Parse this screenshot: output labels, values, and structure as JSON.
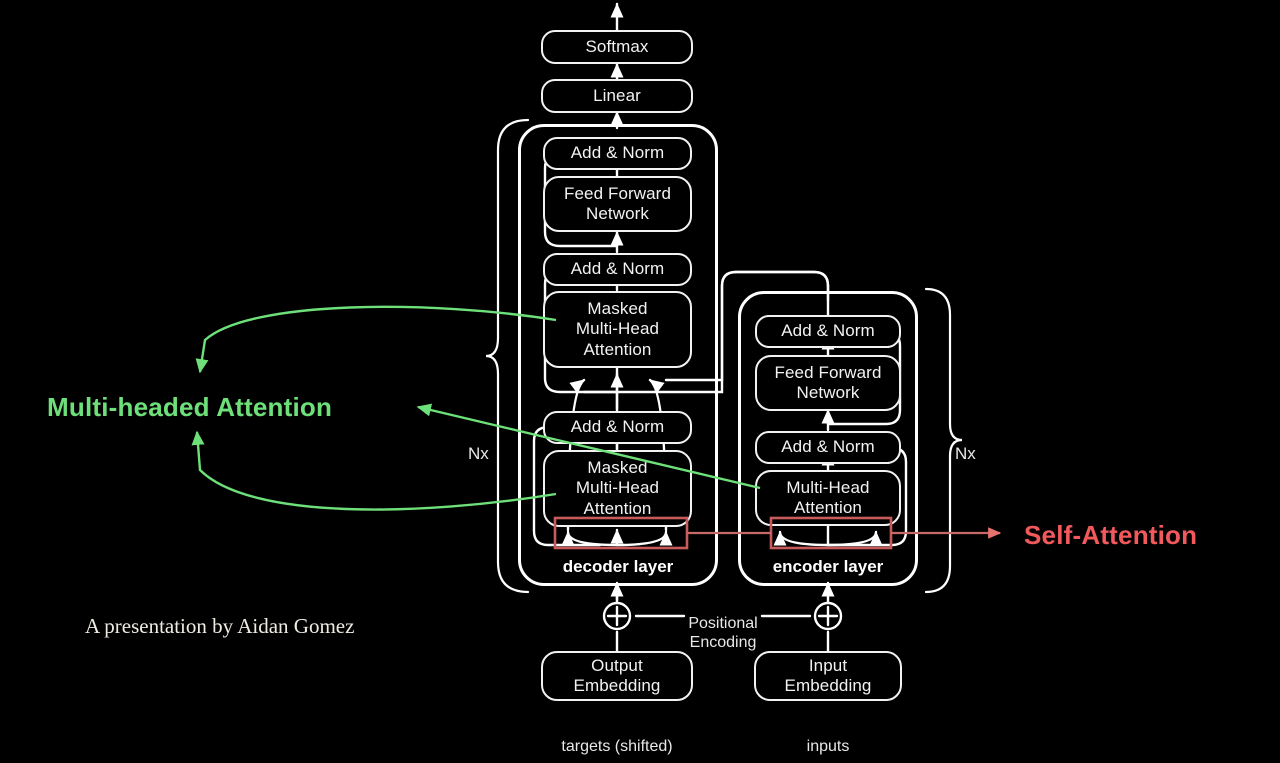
{
  "slide": {
    "background_color": "#000000",
    "credit": "A presentation by Aidan Gomez"
  },
  "colors": {
    "wire": "#ffffff",
    "node_border": "#f2f2f2",
    "text": "#f2f2f2",
    "green_accent": "#6ee07a",
    "red_accent": "#f2595c",
    "red_box": "#c75b5b"
  },
  "output_head": {
    "softmax": "Softmax",
    "linear": "Linear"
  },
  "decoder": {
    "caption": "decoder layer",
    "repeat_label": "Nx",
    "blocks": [
      {
        "id": "dec-add-norm-3",
        "label": "Add & Norm"
      },
      {
        "id": "dec-ffn",
        "label": "Feed Forward\nNetwork"
      },
      {
        "id": "dec-add-norm-2",
        "label": "Add & Norm"
      },
      {
        "id": "dec-cross-attention",
        "label": "Masked\nMulti-Head\nAttention"
      },
      {
        "id": "dec-add-norm-1",
        "label": "Add & Norm"
      },
      {
        "id": "dec-self-attention",
        "label": "Masked\nMulti-Head\nAttention"
      }
    ],
    "embedding": "Output\nEmbedding",
    "input_caption": "targets (shifted)"
  },
  "encoder": {
    "caption": "encoder layer",
    "repeat_label": "Nx",
    "blocks": [
      {
        "id": "enc-add-norm-2",
        "label": "Add & Norm"
      },
      {
        "id": "enc-ffn",
        "label": "Feed Forward\nNetwork"
      },
      {
        "id": "enc-add-norm-1",
        "label": "Add & Norm"
      },
      {
        "id": "enc-self-attention",
        "label": "Multi-Head\nAttention"
      }
    ],
    "embedding": "Input\nEmbedding",
    "input_caption": "inputs"
  },
  "positional_encoding": {
    "label": "Positional\nEncoding",
    "operator": "+"
  },
  "annotations": [
    {
      "id": "multi-headed-attention",
      "text": "Multi-headed Attention",
      "color": "#6ee07a"
    },
    {
      "id": "self-attention",
      "text": "Self-Attention",
      "color": "#f2595c"
    }
  ]
}
